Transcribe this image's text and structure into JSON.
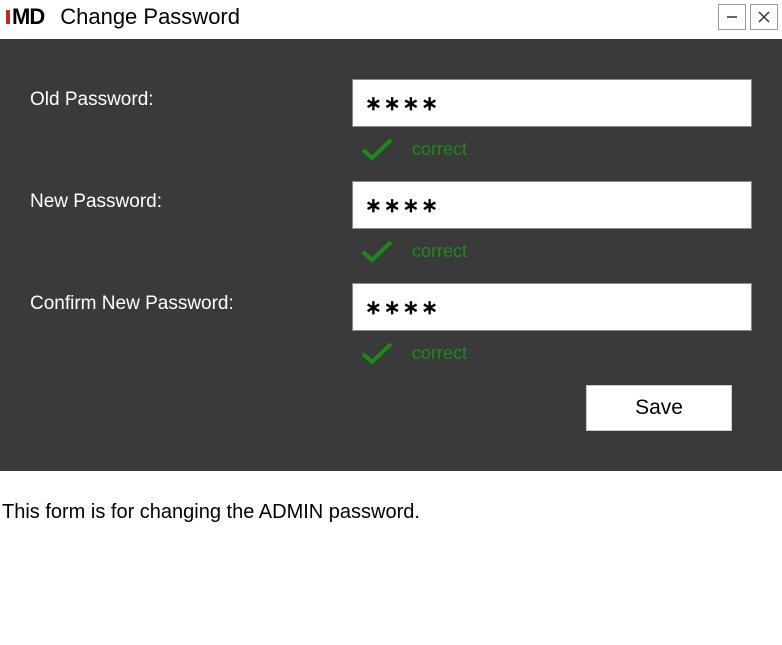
{
  "window": {
    "logo_text": "MD",
    "title": "Change Password"
  },
  "form": {
    "old_password": {
      "label": "Old Password:",
      "value": "∗∗∗∗",
      "status": "correct"
    },
    "new_password": {
      "label": "New Password:",
      "value": "∗∗∗∗",
      "status": "correct"
    },
    "confirm_password": {
      "label": "Confirm New Password:",
      "value": "∗∗∗∗",
      "status": "correct"
    },
    "save_button": "Save"
  },
  "caption": "This form is for changing the ADMIN password."
}
